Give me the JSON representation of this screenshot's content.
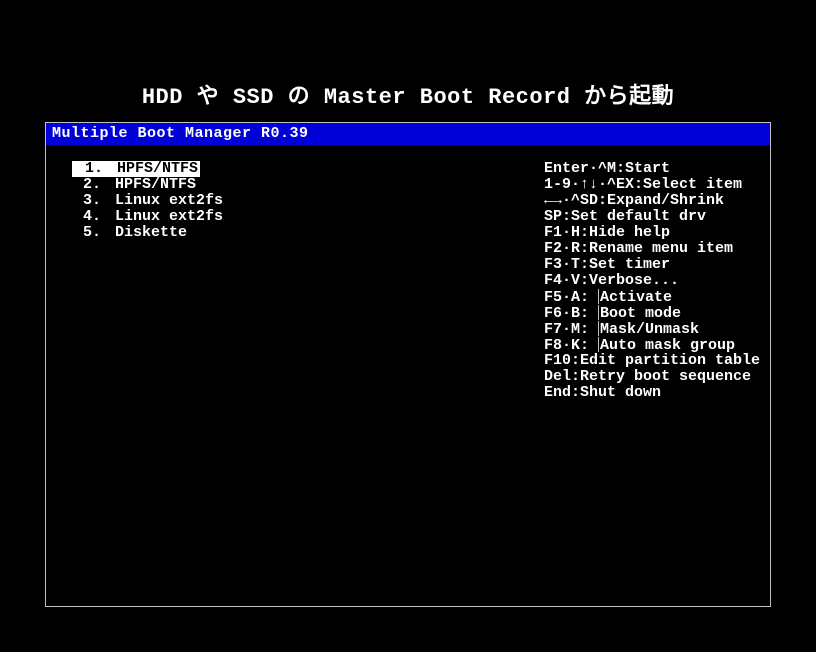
{
  "page": {
    "heading": "HDD や SSD の Master Boot Record から起動"
  },
  "terminal": {
    "title": "Multiple Boot Manager R0.39"
  },
  "boot_items": [
    {
      "num": "1",
      "label": "HPFS/NTFS",
      "selected": true
    },
    {
      "num": "2",
      "label": "HPFS/NTFS",
      "selected": false
    },
    {
      "num": "3",
      "label": "Linux ext2fs",
      "selected": false
    },
    {
      "num": "4",
      "label": "Linux ext2fs",
      "selected": false
    },
    {
      "num": "5",
      "label": "Diskette",
      "selected": false
    }
  ],
  "help_lines": [
    {
      "key": "Enter·^M",
      "sep": ":",
      "desc": "Start",
      "bar": false
    },
    {
      "key": "1-9·↑↓·^EX",
      "sep": ":",
      "desc": "Select item",
      "bar": false
    },
    {
      "key": "←→·^SD",
      "sep": ":",
      "desc": "Expand/Shrink",
      "bar": false
    },
    {
      "key": "SP",
      "sep": ":",
      "desc": "Set default drv",
      "bar": false
    },
    {
      "key": "F1·H",
      "sep": ":",
      "desc": "Hide help",
      "bar": false
    },
    {
      "key": "F2·R",
      "sep": ":",
      "desc": "Rename menu item",
      "bar": false
    },
    {
      "key": "F3·T",
      "sep": ":",
      "desc": "Set timer",
      "bar": false
    },
    {
      "key": "F4·V",
      "sep": ":",
      "desc": "Verbose...",
      "bar": false
    },
    {
      "key": "F5·A",
      "sep": ": ",
      "desc": "Activate",
      "bar": true
    },
    {
      "key": "F6·B",
      "sep": ": ",
      "desc": "Boot mode",
      "bar": true
    },
    {
      "key": "F7·M",
      "sep": ": ",
      "desc": "Mask/Unmask",
      "bar": true
    },
    {
      "key": "F8·K",
      "sep": ": ",
      "desc": "Auto mask group",
      "bar": true
    },
    {
      "key": "F10",
      "sep": ":",
      "desc": "Edit partition table",
      "bar": false
    },
    {
      "key": "Del",
      "sep": ":",
      "desc": "Retry boot sequence",
      "bar": false
    },
    {
      "key": "End",
      "sep": ":",
      "desc": "Shut down",
      "bar": false
    }
  ]
}
